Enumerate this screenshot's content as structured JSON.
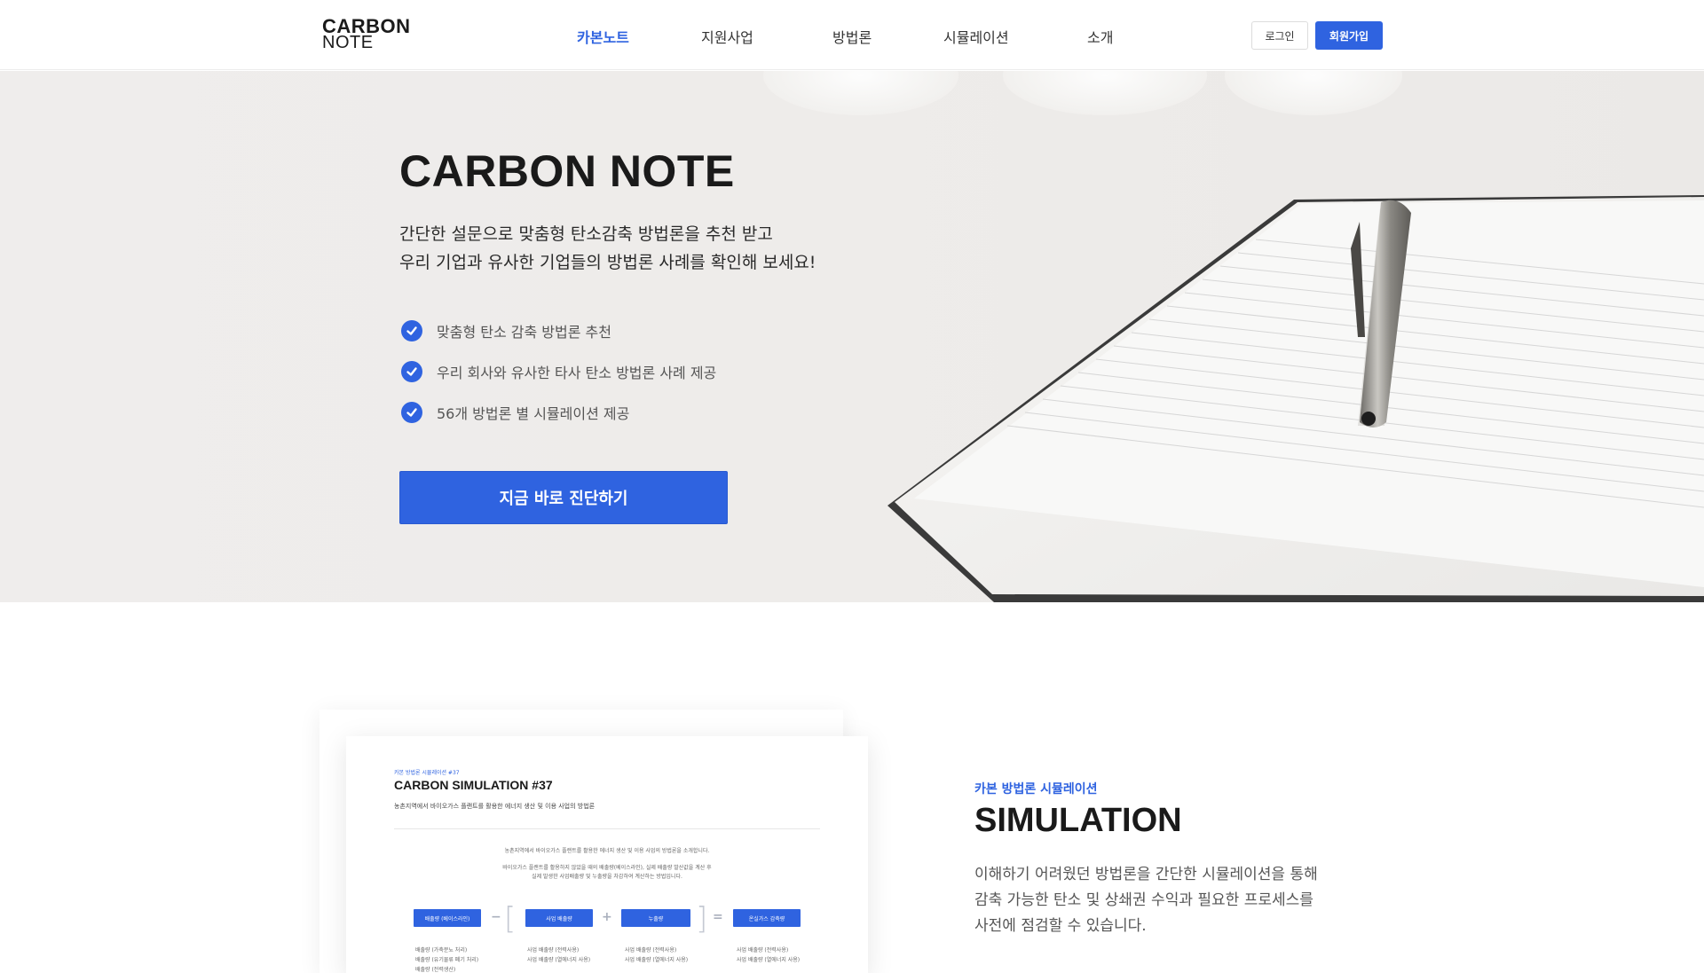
{
  "header": {
    "logo_line1": "CARBON",
    "logo_line2": "NOTE",
    "nav": [
      {
        "label": "카본노트",
        "active": true
      },
      {
        "label": "지원사업",
        "active": false
      },
      {
        "label": "방법론",
        "active": false
      },
      {
        "label": "시뮬레이션",
        "active": false
      },
      {
        "label": "소개",
        "active": false
      }
    ],
    "login_label": "로그인",
    "signup_label": "회원가입"
  },
  "hero": {
    "title": "CARBON NOTE",
    "subtitle_line1": "간단한 설문으로 맞춤형 탄소감축 방법론을 추천 받고",
    "subtitle_line2": "우리 기업과 유사한 기업들의 방법론 사례를 확인해 보세요!",
    "features": [
      "맞춤형 탄소 감축 방법론 추천",
      "우리 회사와 유사한 타사 탄소 방법론 사례 제공",
      "56개 방법론 별 시뮬레이션 제공"
    ],
    "cta_label": "지금 바로 진단하기"
  },
  "simulation": {
    "kicker": "카본 방법론 시뮬레이션",
    "title": "SIMULATION",
    "text_line1": "이해하기 어려웠던 방법론을 간단한 시뮬레이션을 통해",
    "text_line2": "감축 가능한 탄소 및  상쇄권 수익과 필요한 프로세스를",
    "text_line3": "사전에 점검할 수 있습니다.",
    "card": {
      "kicker": "카본 방법론 시뮬레이션 #37",
      "title": "CARBON SIMULATION #37",
      "desc": "농촌지역에서 바이오가스 플랜트를 활용한 에너지 생산 및 이용 사업의 방법론",
      "para1": "농촌지역에서 바이오가스 플랜트를 활용한 에너지 생산 및 이용 사업의 방법론을 소개합니다.",
      "para2": "바이오가스 플랜트를 활용하지 않았을 때의 배출량(베이스라인), 실제 배출량 발산값을 계산 후",
      "para3": "실제 발생한 사업배출량 및 누출량을 차감하여 계산하는 방법입니다.",
      "boxes": [
        "배출량 (베이스라인)",
        "사업 배출량",
        "누출량",
        "온실가스 감축량"
      ],
      "ops": [
        "−",
        "+",
        "="
      ],
      "bracket_open": "[",
      "bracket_close": "]",
      "notes": [
        [
          "배출량 (가축분뇨 처리)",
          "배출량 (유기물류 폐기 처리)",
          "배출량 (전력생산)"
        ],
        [
          "사업 배출량 (전력사용)",
          "사업 배출량 (열에너지 사용)"
        ],
        [
          "사업 배출량 (전력사용)",
          "사업 배출량 (열에너지 사용)"
        ],
        [
          "사업 배출량 (전력사용)",
          "사업 배출량 (열에너지 사용)"
        ]
      ]
    }
  },
  "colors": {
    "accent": "#2f63e0",
    "hero_bg": "#eeecea",
    "text_dark": "#1a1a1a"
  },
  "icons": {
    "feature_check": "check-circle-icon"
  }
}
